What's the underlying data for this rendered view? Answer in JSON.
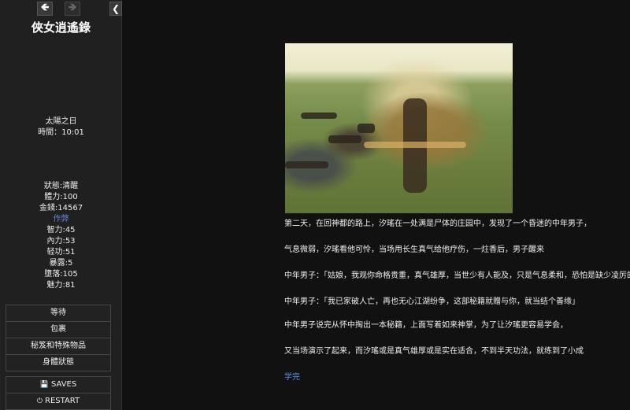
{
  "nav": {
    "back_icon": "🡸",
    "forward_icon": "🡺",
    "collapse_icon": "❮"
  },
  "story_title": "俠女逍遙錄",
  "time_block": {
    "day": "太陽之日",
    "time": "時間：10:01"
  },
  "stats": {
    "status": "狀態:清醒",
    "stamina": "體力:100",
    "money": "金錢:14567",
    "cheat": "作弊",
    "intelligence": "智力:45",
    "inner_power": "內力:53",
    "agility": "轻功:51",
    "exposure": "暴露:5",
    "depravity": "墮落:105",
    "charm": "魅力:81"
  },
  "main_menu": [
    "等待",
    "包裹",
    "秘笈和特殊物品",
    "身體狀態"
  ],
  "sys_menu": {
    "saves_icon": "💾",
    "saves": "SAVES",
    "restart_icon": "⏻",
    "restart": "RESTART"
  },
  "passage": {
    "image_alt": "scene-illustration",
    "paragraphs": [
      "第二天，在回神都的路上，汐瑤在一处满是尸体的庄园中，发现了一个昏迷的中年男子，",
      "气息微弱，汐瑤看他可怜，当场用长生真气给他疗伤，一炷香后，男子醒来",
      "中年男子：「姑娘，我观你命格贵重，真气雄厚，当世少有人能及，只是气息柔和，恐怕是缺少凌厉的杀招」",
      "中年男子：「我已家破人亡，再也无心江湖纷争，这部秘籍就赠与你，就当结个善缘」",
      "中年男子说完从怀中掏出一本秘籍，上面写着如来神掌，为了让汐瑤更容易学会，",
      "又当场演示了起来，而汐瑤或是真气雄厚或是实在适合，不到半天功法，就练到了小成"
    ],
    "continue_link": "学完"
  },
  "colors": {
    "background": "#111111",
    "sidebar": "#202020",
    "link": "#5f8ee0"
  }
}
